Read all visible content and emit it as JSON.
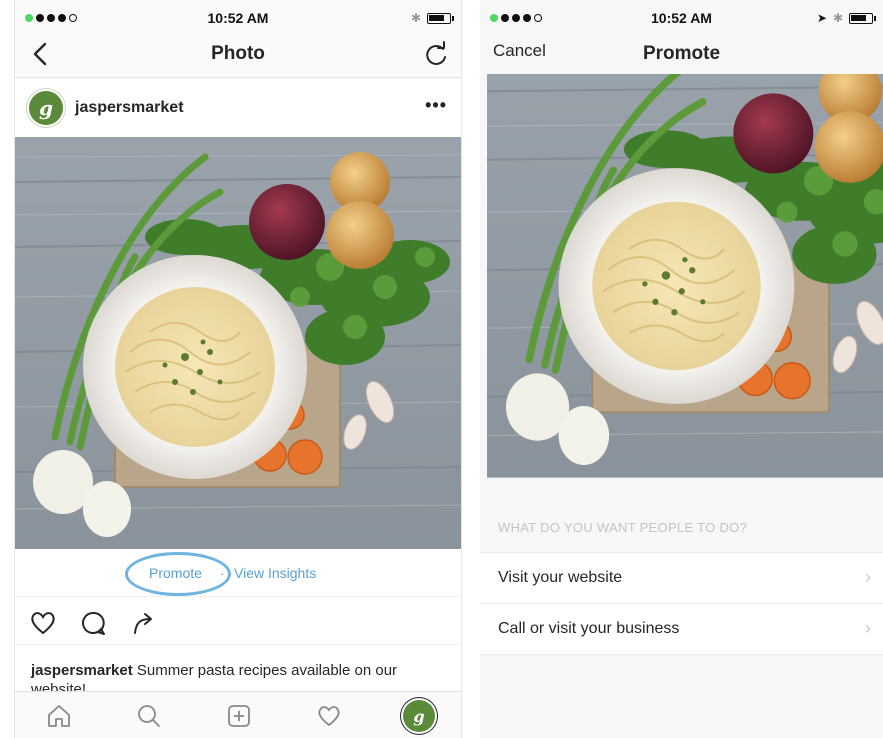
{
  "left_screen": {
    "status": {
      "time": "10:52 AM",
      "carrier_icon": "signal-dots",
      "wifi_icon": "wifi-icon",
      "bluetooth_icon": "bluetooth-icon"
    },
    "nav": {
      "title": "Photo",
      "back_icon": "chevron-left-icon",
      "refresh_icon": "refresh-icon"
    },
    "post": {
      "username": "jaspersmarket",
      "avatar_letter": "g",
      "more_label": "•••",
      "promote_label": "Promote",
      "separator": "·",
      "insights_label": "View Insights",
      "caption_user": "jaspersmarket",
      "caption_text": " Summer pasta recipes available on our website!"
    },
    "tabbar": {
      "items": [
        "home-icon",
        "search-icon",
        "add-post-icon",
        "activity-heart-icon",
        "profile-avatar"
      ],
      "avatar_letter": "g"
    }
  },
  "right_screen": {
    "status": {
      "time": "10:52 AM"
    },
    "nav": {
      "title": "Promote",
      "cancel_label": "Cancel"
    },
    "question": "WHAT DO YOU WANT PEOPLE TO DO?",
    "options": [
      {
        "label": "Visit your website",
        "chevron": "›"
      },
      {
        "label": "Call or visit your business",
        "chevron": "›"
      }
    ]
  },
  "colors": {
    "link_blue": "#5b9fd6",
    "highlight_ring": "#6fb3e0",
    "brand_green": "#5a8a3a"
  }
}
